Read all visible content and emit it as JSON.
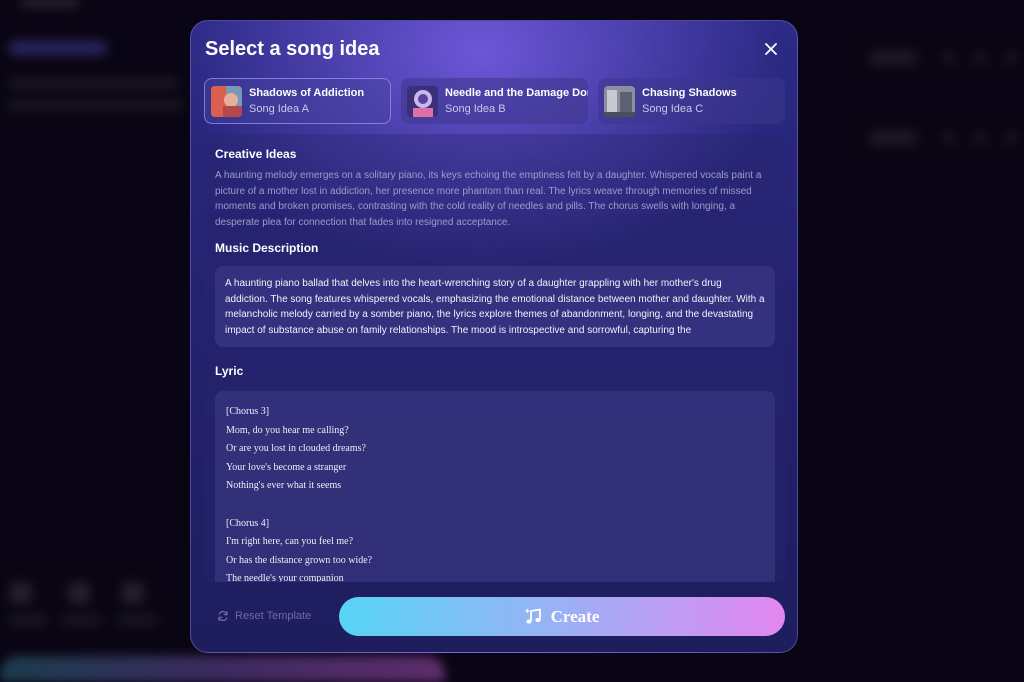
{
  "modal": {
    "title": "Select a song idea",
    "close_icon": "close-icon"
  },
  "tabs": [
    {
      "title": "Shadows of Addiction",
      "subtitle": "Song Idea A",
      "active": true
    },
    {
      "title": "Needle and the Damage Done",
      "subtitle": "Song Idea B",
      "active": false
    },
    {
      "title": "Chasing Shadows",
      "subtitle": "Song Idea C",
      "active": false
    }
  ],
  "creative": {
    "heading": "Creative Ideas",
    "text": "A haunting melody emerges on a solitary piano, its keys echoing the emptiness felt by a daughter. Whispered vocals paint a picture of a mother lost in addiction, her presence more phantom than real. The lyrics weave through memories of missed moments and broken promises, contrasting with the cold reality of needles and pills. The chorus swells with longing, a desperate plea for connection that fades into resigned acceptance."
  },
  "music": {
    "heading": "Music Description",
    "text": "A haunting piano ballad that delves into the heart-wrenching story of a daughter grappling with her mother's drug addiction. The song features whispered vocals, emphasizing the emotional distance between mother and daughter. With a melancholic melody carried by a somber piano, the lyrics explore themes of abandonment, longing, and the devastating impact of substance abuse on family relationships. The mood is introspective and sorrowful, capturing the"
  },
  "lyric": {
    "heading": "Lyric",
    "lines": [
      "[Chorus 3]",
      "Mom, do you hear me calling?",
      "Or are you lost in clouded dreams?",
      "Your love's become a stranger",
      "Nothing's ever what it seems",
      "",
      "[Chorus 4]",
      "I'm right here, can you feel me?",
      "Or has the distance grown too wide?",
      "The needle's your companion"
    ]
  },
  "footer": {
    "reset_label": "Reset Template",
    "create_label": "Create"
  },
  "colors": {
    "modal_bg": "#24226f",
    "create_gradient_start": "#56d4f5",
    "create_gradient_end": "#e387f0",
    "reset_text": "#6d6aa6"
  }
}
